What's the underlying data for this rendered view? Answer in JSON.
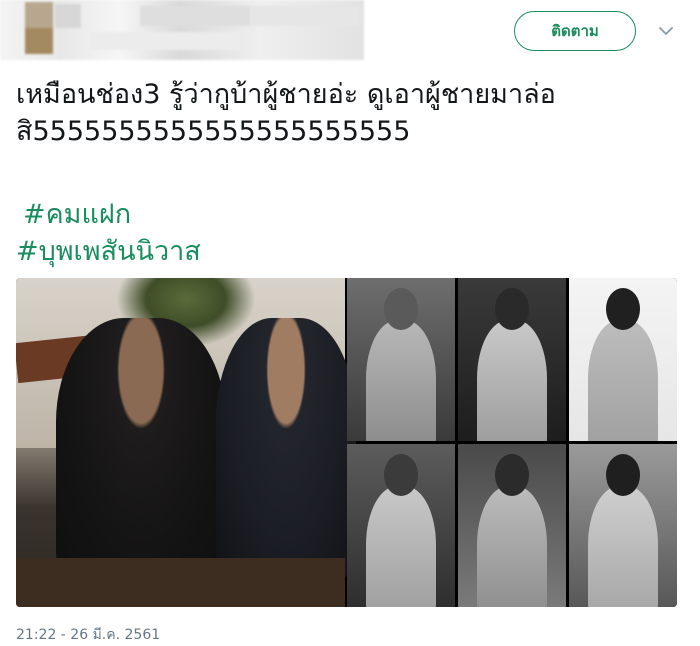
{
  "header": {
    "follow_label": "ติดตาม",
    "menu_icon": "chevron-down-icon"
  },
  "tweet": {
    "text_line1": "เหมือนช่อง3 รู้ว่ากูบ้าผู้ชายอ่ะ ดูเอาผู้ชายมาล่อ",
    "text_line2": "สิ5555555555555555555555",
    "hashtags": [
      "#คมแฝก",
      "#บุพเพสันนิวาส"
    ],
    "timestamp": "21:22 - 26 มี.ค. 2561"
  },
  "colors": {
    "accent": "#1a8d5f",
    "text": "#14171a",
    "muted": "#657786"
  }
}
